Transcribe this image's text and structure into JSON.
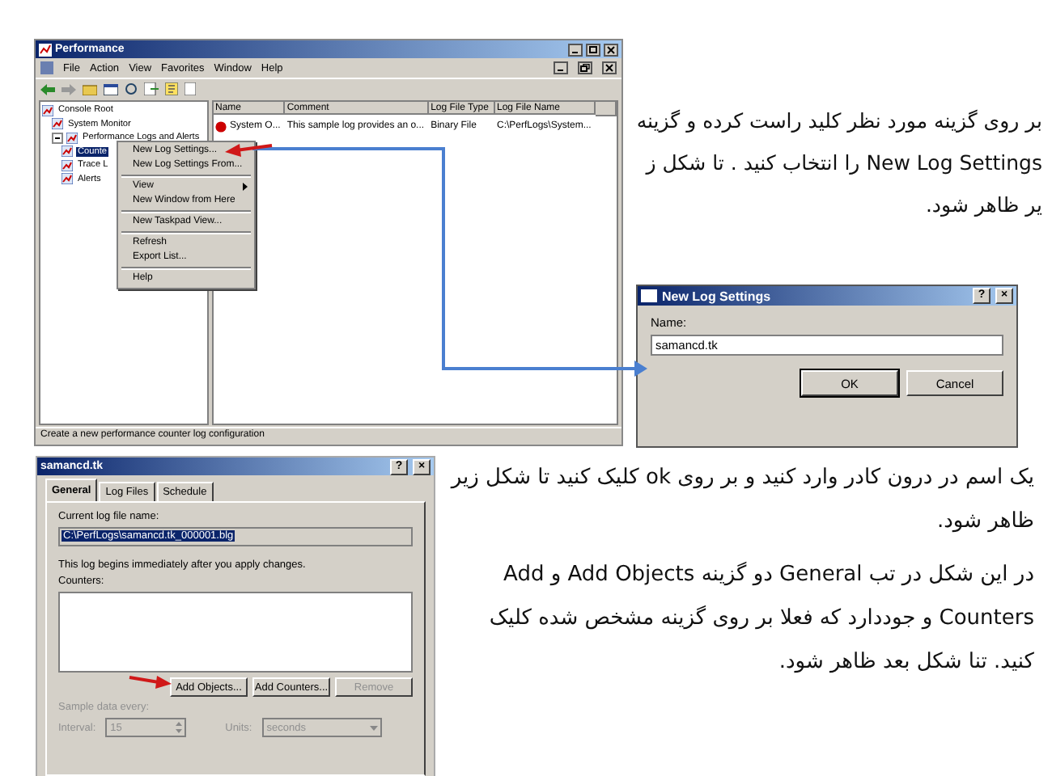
{
  "main_window": {
    "title": "Performance",
    "menu": [
      "File",
      "Action",
      "View",
      "Favorites",
      "Window",
      "Help"
    ],
    "tree": [
      {
        "label": "Console Root",
        "selected": false,
        "children": [
          {
            "label": "System Monitor",
            "selected": false
          },
          {
            "label": "Performance Logs and Alerts",
            "selected": false,
            "expanded": true,
            "children": [
              {
                "label": "Counte",
                "selected": true
              },
              {
                "label": "Trace L",
                "selected": false
              },
              {
                "label": "Alerts",
                "selected": false
              }
            ]
          }
        ]
      }
    ],
    "list": {
      "columns": [
        "Name",
        "Comment",
        "Log File Type",
        "Log File Name"
      ],
      "rows": [
        [
          "System O...",
          "This sample log provides an o...",
          "Binary File",
          "C:\\PerfLogs\\System..."
        ]
      ]
    },
    "context_menu": [
      {
        "kind": "item",
        "label": "New Log Settings..."
      },
      {
        "kind": "item",
        "label": "New Log Settings From..."
      },
      {
        "kind": "separator"
      },
      {
        "kind": "submenu",
        "label": "View"
      },
      {
        "kind": "item",
        "label": "New Window from Here"
      },
      {
        "kind": "separator"
      },
      {
        "kind": "item",
        "label": "New Taskpad View..."
      },
      {
        "kind": "separator"
      },
      {
        "kind": "item",
        "label": "Refresh"
      },
      {
        "kind": "item",
        "label": "Export List..."
      },
      {
        "kind": "separator"
      },
      {
        "kind": "item",
        "label": "Help"
      }
    ],
    "status_bar": "Create a new performance counter log configuration"
  },
  "instruction_1": "بر روی گزینه مورد نظر کلید راست کرده و گزینه New Log Settings را انتخاب کنید . تا شکل ز یر ظاهر شود.",
  "new_log_dialog": {
    "title": "New Log Settings",
    "title_buttons": [
      "?",
      "×"
    ],
    "name_label": "Name:",
    "name_value": "samancd.tk",
    "buttons": [
      "OK",
      "Cancel"
    ]
  },
  "properties_dialog": {
    "title": "samancd.tk",
    "title_buttons": [
      "?",
      "×"
    ],
    "tabs": [
      {
        "label": "General",
        "selected": true
      },
      {
        "label": "Log Files",
        "selected": false
      },
      {
        "label": "Schedule",
        "selected": false
      }
    ],
    "log_file_label": "Current log file name:",
    "log_file_value": "C:\\PerfLogs\\samancd.tk_000001.blg",
    "note": "This log begins immediately after you apply changes.",
    "counters_label": "Counters:",
    "buttons": [
      {
        "label": "Add Objects...",
        "disabled": false
      },
      {
        "label": "Add Counters...",
        "disabled": false
      },
      {
        "label": "Remove",
        "disabled": true
      }
    ],
    "sampling": {
      "disabled": true,
      "label": "Sample data every:",
      "interval_label": "Interval:",
      "interval_value": "15",
      "units_label": "Units:",
      "units_value": "seconds"
    }
  },
  "instruction_2": "یک اسم در درون کادر وارد کنید و بر روی ok کلیک کنید تا شکل زیر ظاهر شود.",
  "instruction_3": "در این شکل در تب General  دو گزینه Add Objects و Add Counters  و جوددارد که فعلا بر روی گزینه مشخص شده کلیک کنید. تنا شکل بعد ظاهر شود."
}
